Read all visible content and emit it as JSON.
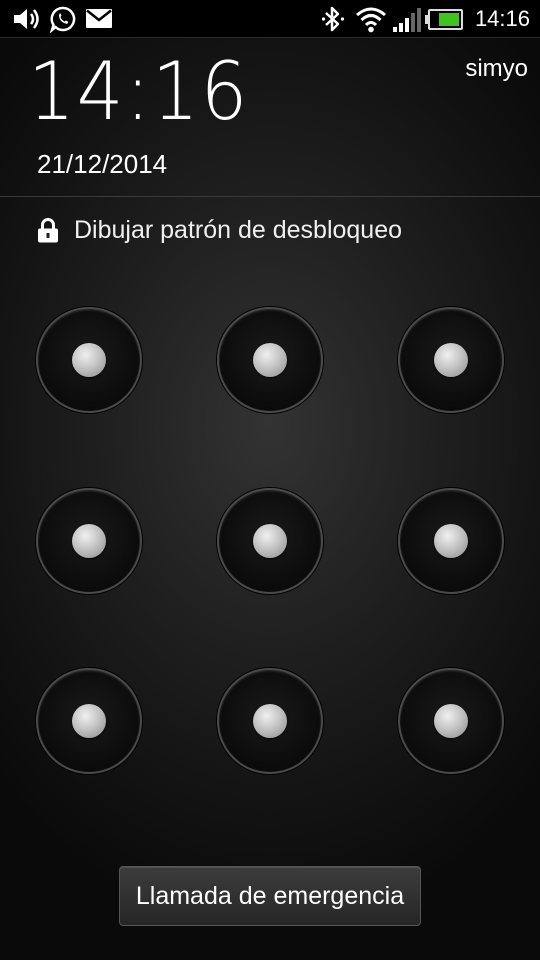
{
  "status_bar": {
    "time": "14:16",
    "left_icons": [
      "volume-icon",
      "whatsapp-icon",
      "mail-icon"
    ],
    "right_icons": [
      "bluetooth-icon",
      "wifi-icon",
      "signal-icon",
      "battery-icon"
    ]
  },
  "lockscreen": {
    "clock": "14:16",
    "date": "21/12/2014",
    "carrier": "simyo",
    "prompt": "Dibujar patrón de desbloqueo",
    "pattern_grid": {
      "rows": 3,
      "cols": 3
    },
    "emergency_button": "Llamada de emergencia"
  },
  "colors": {
    "background": "#1f1f1f",
    "text": "#ffffff",
    "battery_fill": "#3fc41f"
  }
}
